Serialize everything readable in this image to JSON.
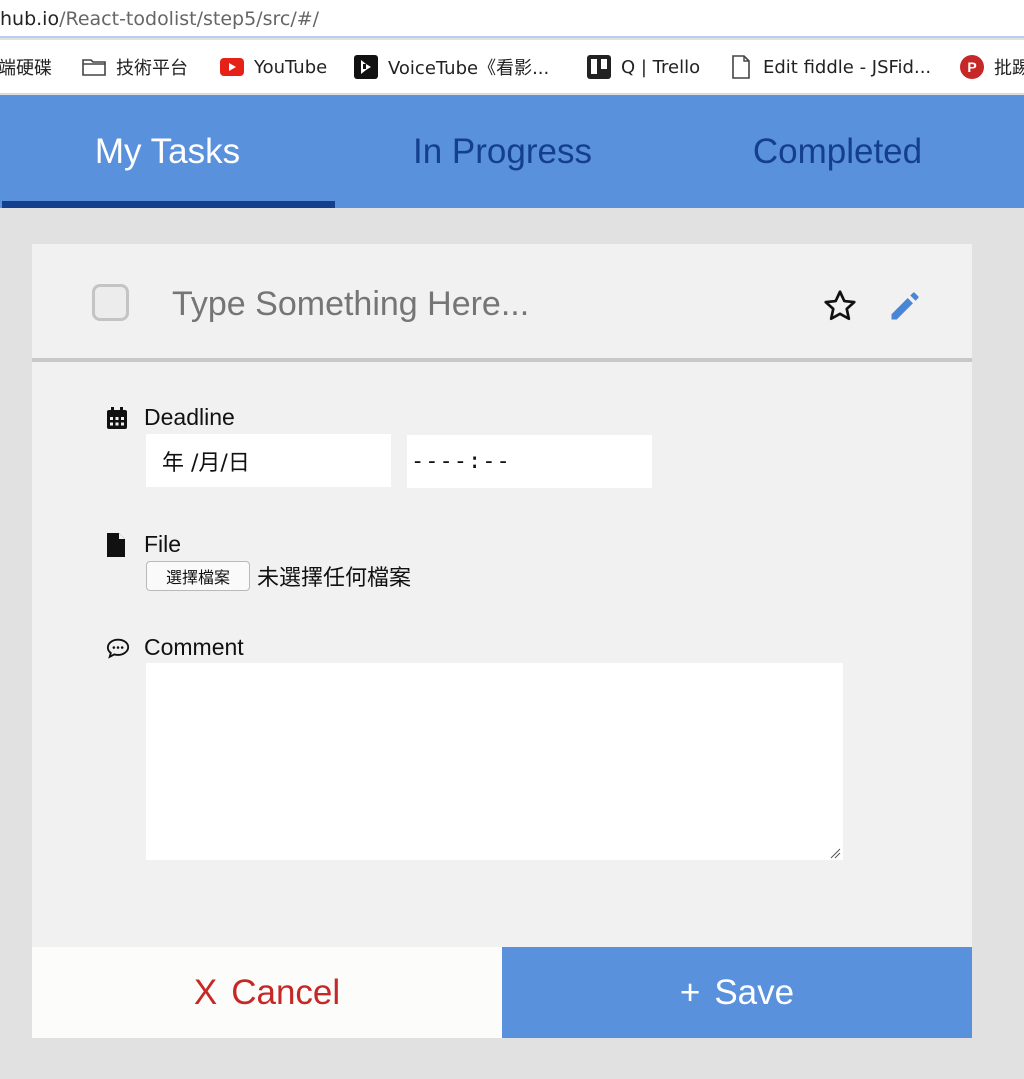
{
  "browser": {
    "url_host": "hub.io",
    "url_path": "/React-todolist/step5/src/#/",
    "bookmarks": [
      {
        "label": "端硬碟",
        "icon": "none"
      },
      {
        "label": "技術平台",
        "icon": "folder-icon"
      },
      {
        "label": "YouTube",
        "icon": "youtube-icon"
      },
      {
        "label": "VoiceTube《看影...",
        "icon": "voicetube-icon"
      },
      {
        "label": "Q | Trello",
        "icon": "trello-icon"
      },
      {
        "label": "Edit fiddle - JSFid...",
        "icon": "page-icon"
      },
      {
        "label": "批踢",
        "icon": "ptt-icon"
      }
    ]
  },
  "tabs": [
    {
      "label": "My Tasks",
      "active": true
    },
    {
      "label": "In Progress",
      "active": false
    },
    {
      "label": "Completed",
      "active": false
    }
  ],
  "task": {
    "title_placeholder": "Type Something Here...",
    "title_value": "",
    "starred": false,
    "done": false
  },
  "deadline": {
    "label": "Deadline",
    "date_display": "年 /月/日",
    "time_display": "----:--"
  },
  "file": {
    "label": "File",
    "button_label": "選擇檔案",
    "status": "未選擇任何檔案"
  },
  "comment": {
    "label": "Comment",
    "value": ""
  },
  "actions": {
    "cancel_prefix": "X",
    "cancel_label": "Cancel",
    "save_prefix": "+",
    "save_label": "Save"
  },
  "colors": {
    "primary": "#5a91dd",
    "tab_inactive_text": "#143f8c",
    "cancel_text": "#c62828",
    "edit_icon": "#4a86d8"
  }
}
